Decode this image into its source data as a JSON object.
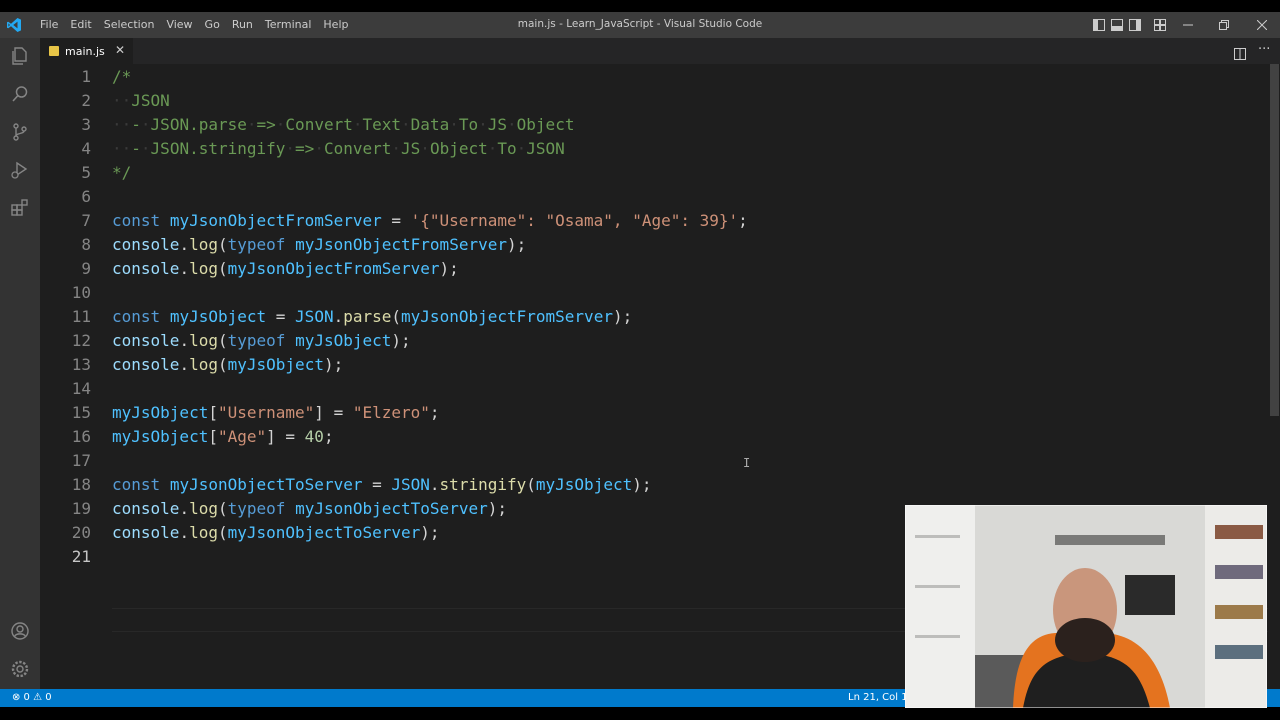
{
  "window": {
    "title": "main.js - Learn_JavaScript - Visual Studio Code",
    "menu": [
      "File",
      "Edit",
      "Selection",
      "View",
      "Go",
      "Run",
      "Terminal",
      "Help"
    ]
  },
  "tab": {
    "label": "main.js",
    "close": "✕"
  },
  "editor": {
    "line_numbers": [
      "1",
      "2",
      "3",
      "4",
      "5",
      "6",
      "7",
      "8",
      "9",
      "10",
      "11",
      "12",
      "13",
      "14",
      "15",
      "16",
      "17",
      "18",
      "19",
      "20",
      "21"
    ]
  },
  "status": {
    "problems": "⊗ 0 ⚠ 0",
    "cursor": "Ln 21, Col 1"
  },
  "colors": {
    "accent": "#007acc",
    "editor_bg": "#1e1e1e",
    "keyword": "#569cd6",
    "string": "#ce9178",
    "comment": "#6a9955"
  }
}
